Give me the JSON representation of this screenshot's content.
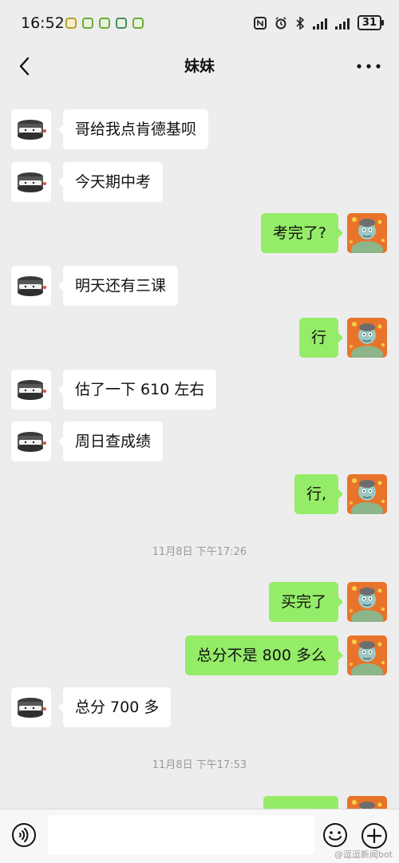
{
  "status_bar": {
    "time": "16:52",
    "battery": "31"
  },
  "header": {
    "title": "妹妹"
  },
  "messages": [
    {
      "side": "left",
      "text": "哥给我点肯德基呗"
    },
    {
      "side": "left",
      "text": "今天期中考"
    },
    {
      "side": "right",
      "text": "考完了?"
    },
    {
      "side": "left",
      "text": "明天还有三课"
    },
    {
      "side": "right",
      "text": "行"
    },
    {
      "side": "left",
      "text": "估了一下 610 左右"
    },
    {
      "side": "left",
      "text": "周日查成绩"
    },
    {
      "side": "right",
      "text": "行,"
    },
    {
      "side": "right",
      "text": "买完了"
    },
    {
      "side": "right",
      "text": "总分不是 800 多么"
    },
    {
      "side": "left",
      "text": "总分 700 多"
    },
    {
      "side": "right",
      "text": ""
    }
  ],
  "timestamps": [
    "11月8日 下午17:26",
    "11月8日 下午17:53"
  ],
  "input": {
    "value": "",
    "placeholder": ""
  },
  "watermark": "@逗逗新闻bot",
  "colors": {
    "background": "#ededed",
    "outgoing_bubble": "#95ec69",
    "incoming_bubble": "#ffffff"
  }
}
